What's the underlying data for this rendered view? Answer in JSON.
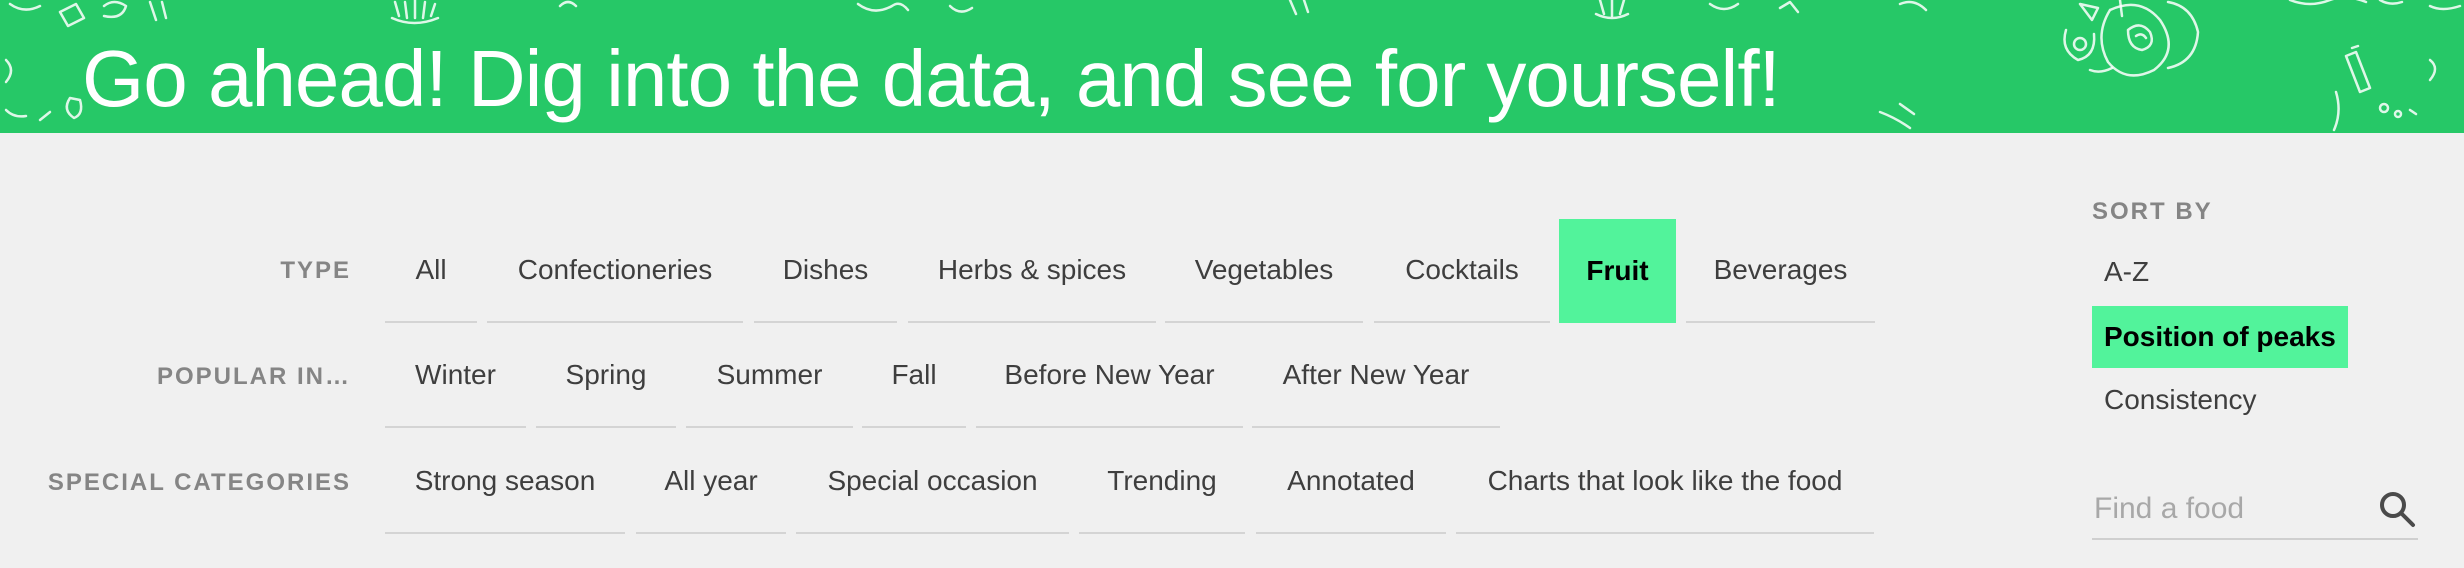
{
  "banner": {
    "title": "Go ahead! Dig into the data, and see for yourself!",
    "color": "#26c867"
  },
  "filters": {
    "type": {
      "label": "TYPE",
      "items": [
        "All",
        "Confectioneries",
        "Dishes",
        "Herbs & spices",
        "Vegetables",
        "Cocktails",
        "Fruit",
        "Beverages"
      ],
      "selected": "Fruit"
    },
    "popular": {
      "label": "POPULAR IN…",
      "items": [
        "Winter",
        "Spring",
        "Summer",
        "Fall",
        "Before New Year",
        "After New Year"
      ]
    },
    "special": {
      "label": "SPECIAL CATEGORIES",
      "items": [
        "Strong season",
        "All year",
        "Special occasion",
        "Trending",
        "Annotated",
        "Charts that look like the food"
      ]
    }
  },
  "sort": {
    "heading": "SORT BY",
    "options": [
      "A-Z",
      "Position of peaks",
      "Consistency"
    ],
    "selected": "Position of peaks"
  },
  "search": {
    "placeholder": "Find a food",
    "value": ""
  },
  "colors": {
    "accent": "#52f39b",
    "label_gray": "#858585",
    "background": "#f0f0f0"
  }
}
